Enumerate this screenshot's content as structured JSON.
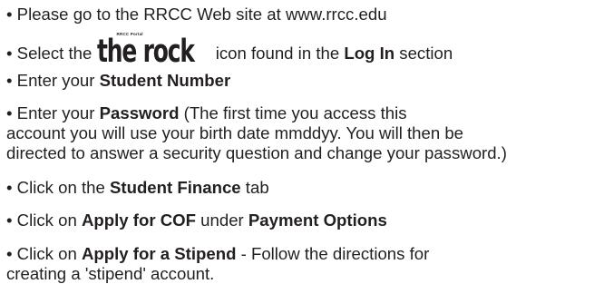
{
  "instructions": {
    "l1": {
      "text": "• Please go to the RRCC Web site at www.rrcc.edu"
    },
    "l2": {
      "pre": "• Select the ",
      "post": " icon found in the ",
      "bold": "Log In",
      "end": " section"
    },
    "l3": {
      "pre": "• Enter your ",
      "bold": "Student Number"
    },
    "l4": {
      "pre": "• Enter your ",
      "bold": "Password",
      "post": " (The first time you access this",
      "cont1": "account you will use your birth date mmddyy.  You will then be",
      "cont2": "directed to answer a security question and change your password.)"
    },
    "l5": {
      "pre": "• Click on the ",
      "bold": "Student Finance",
      "post": " tab"
    },
    "l6": {
      "pre": "• Click on ",
      "bold1": "Apply for COF",
      "mid": " under ",
      "bold2": "Payment Options"
    },
    "l7": {
      "pre": "• Click on ",
      "bold": "Apply for a Stipend",
      "post": " - Follow the directions for",
      "cont": "creating a 'stipend' account."
    }
  },
  "logo": {
    "caption": "RRCC Portal",
    "text": "the rock",
    "icon": "rrcc-the-rock-logo"
  }
}
